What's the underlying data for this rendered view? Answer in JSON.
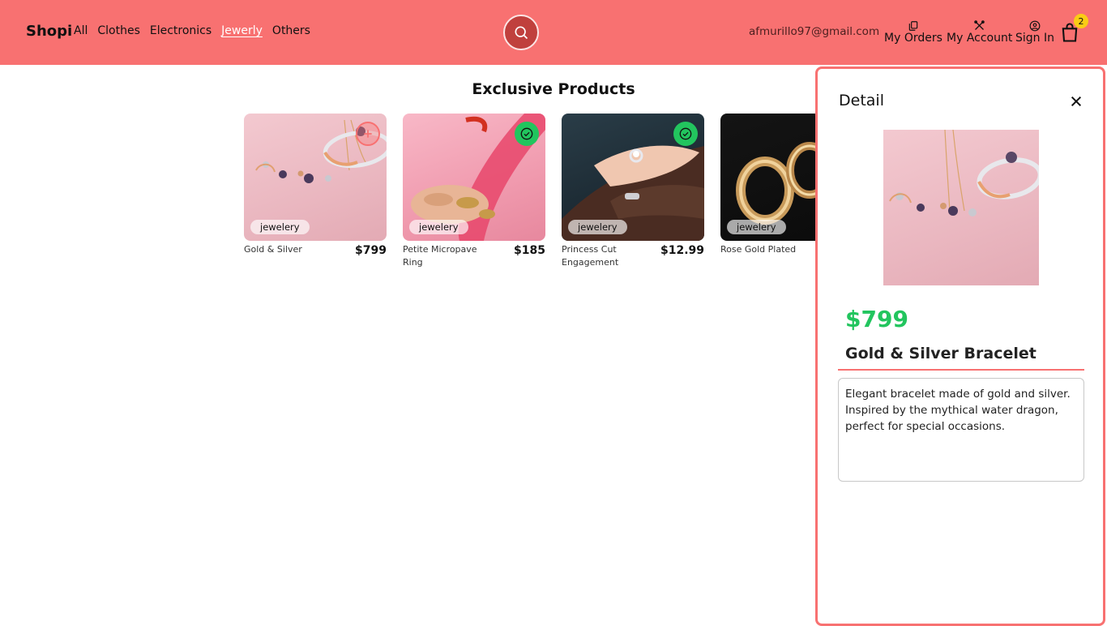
{
  "nav": {
    "brand": "Shopi",
    "links": [
      {
        "label": "All"
      },
      {
        "label": "Clothes"
      },
      {
        "label": "Electronics"
      },
      {
        "label": "Jewerly"
      },
      {
        "label": "Others"
      }
    ],
    "active_link": "Jewerly",
    "email": "afmurillo97@gmail.com",
    "my_orders": "My Orders",
    "my_account": "My Account",
    "sign_in": "Sign In",
    "cart_count": "2"
  },
  "main": {
    "title": "Exclusive Products",
    "products": [
      {
        "category": "jewelery",
        "name": "Gold & Silver",
        "price": "$799",
        "state": "add"
      },
      {
        "category": "jewelery",
        "name": "Petite Micropave Ring",
        "price": "$185",
        "state": "added"
      },
      {
        "category": "jewelery",
        "name": "Princess Cut Engagement",
        "price": "$12.99",
        "state": "added"
      },
      {
        "category": "jewelery",
        "name": "Rose Gold Plated",
        "price": "",
        "state": "none"
      }
    ]
  },
  "detail": {
    "title": "Detail",
    "price": "$799",
    "name": "Gold & Silver Bracelet",
    "description": "Elegant bracelet made of gold and silver. Inspired by the mythical water dragon, perfect for special occasions."
  },
  "colors": {
    "navbar": "#f87171",
    "accent_green": "#22c55e",
    "badge": "#facc15"
  }
}
